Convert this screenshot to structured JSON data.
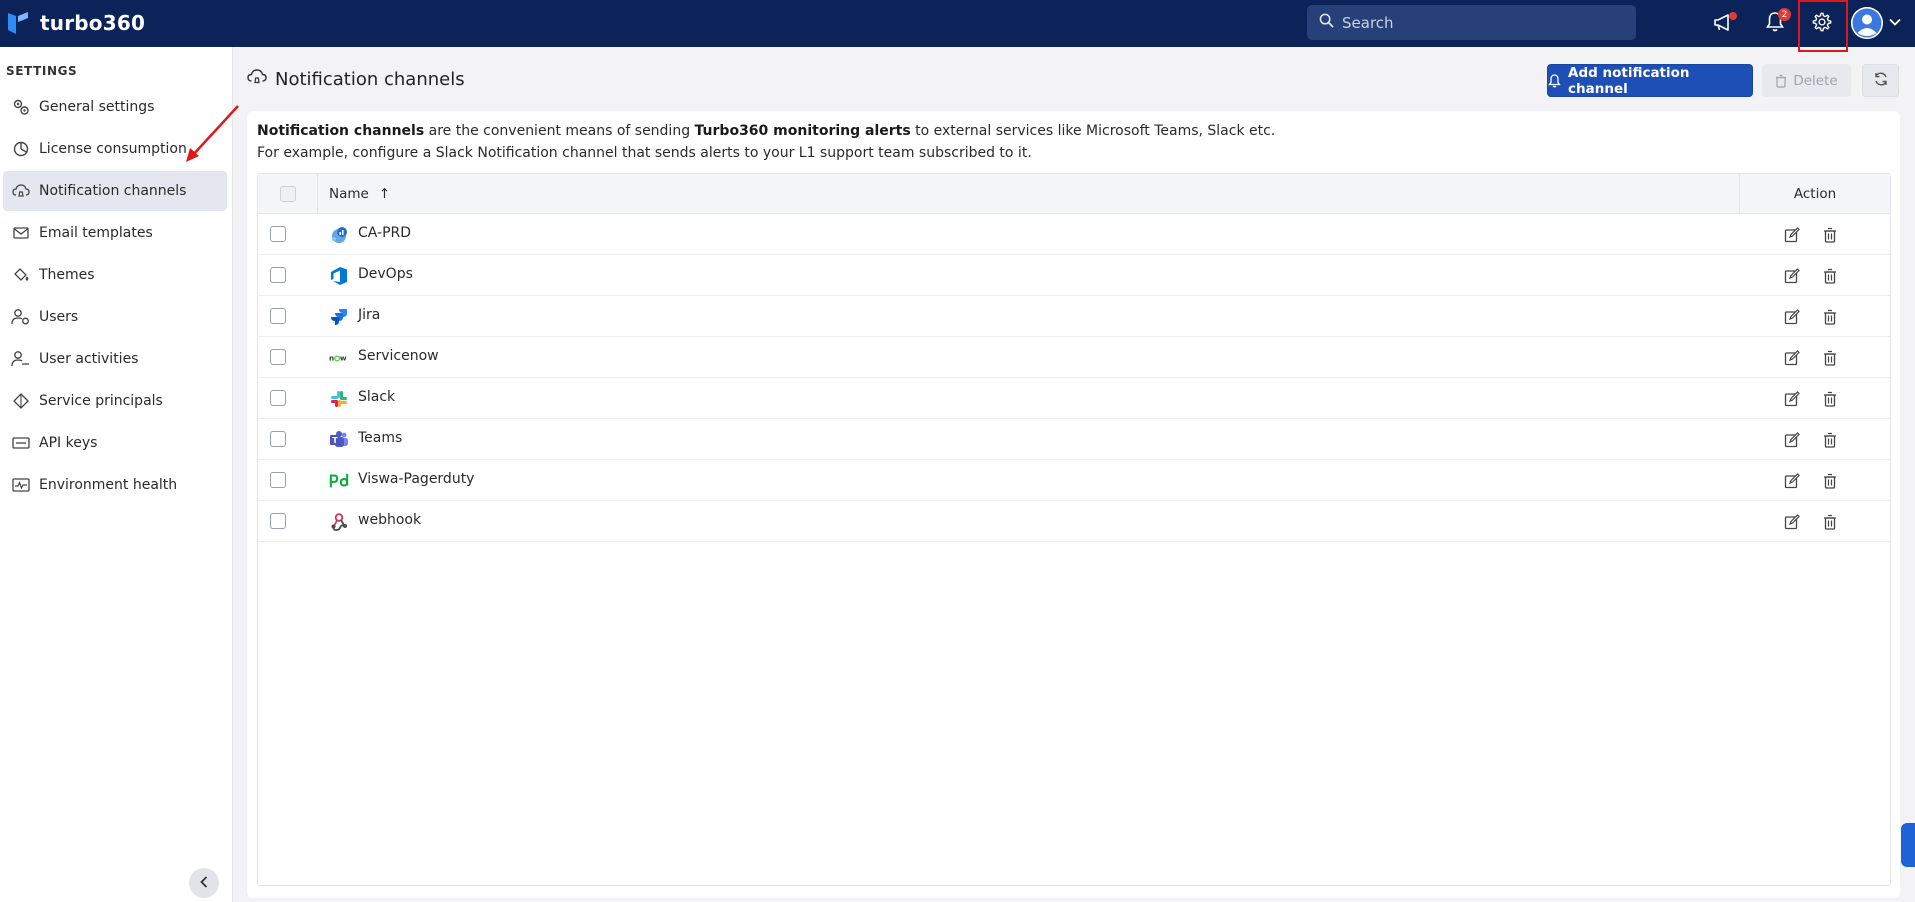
{
  "header": {
    "brand": "turbo360",
    "search_placeholder": "Search",
    "notifications_count": "2"
  },
  "sidebar": {
    "title": "SETTINGS",
    "items": [
      {
        "label": "General settings",
        "icon": "gears-icon"
      },
      {
        "label": "License consumption",
        "icon": "pie-chart-icon"
      },
      {
        "label": "Notification channels",
        "icon": "cloud-bell-icon",
        "active": true
      },
      {
        "label": "Email templates",
        "icon": "envelope-icon"
      },
      {
        "label": "Themes",
        "icon": "paint-bucket-icon"
      },
      {
        "label": "Users",
        "icon": "user-gear-icon"
      },
      {
        "label": "User activities",
        "icon": "user-activity-icon"
      },
      {
        "label": "Service principals",
        "icon": "diamond-icon"
      },
      {
        "label": "API keys",
        "icon": "key-card-icon"
      },
      {
        "label": "Environment health",
        "icon": "pulse-icon"
      }
    ]
  },
  "main": {
    "title": "Notification channels",
    "add_button": "Add notification channel",
    "delete_button": "Delete",
    "description": {
      "bold1": "Notification channels",
      "text1": " are the convenient means of sending ",
      "bold2": "Turbo360 monitoring alerts",
      "text2": " to external services like Microsoft Teams, Slack etc.",
      "line2": "For example, configure a Slack Notification channel that sends alerts to your L1 support team subscribed to it."
    },
    "table": {
      "col_name": "Name",
      "sort_indicator": "↑",
      "col_action": "Action",
      "rows": [
        {
          "name": "CA-PRD",
          "icon": "azure-monitor-icon"
        },
        {
          "name": "DevOps",
          "icon": "azure-devops-icon"
        },
        {
          "name": "Jira",
          "icon": "jira-icon"
        },
        {
          "name": "Servicenow",
          "icon": "servicenow-icon"
        },
        {
          "name": "Slack",
          "icon": "slack-icon"
        },
        {
          "name": "Teams",
          "icon": "teams-icon"
        },
        {
          "name": "Viswa-Pagerduty",
          "icon": "pagerduty-icon"
        },
        {
          "name": "webhook",
          "icon": "webhook-icon"
        }
      ]
    }
  },
  "colors": {
    "topbar": "#0b2359",
    "primary": "#1e4fb6",
    "highlight": "#e01818"
  }
}
